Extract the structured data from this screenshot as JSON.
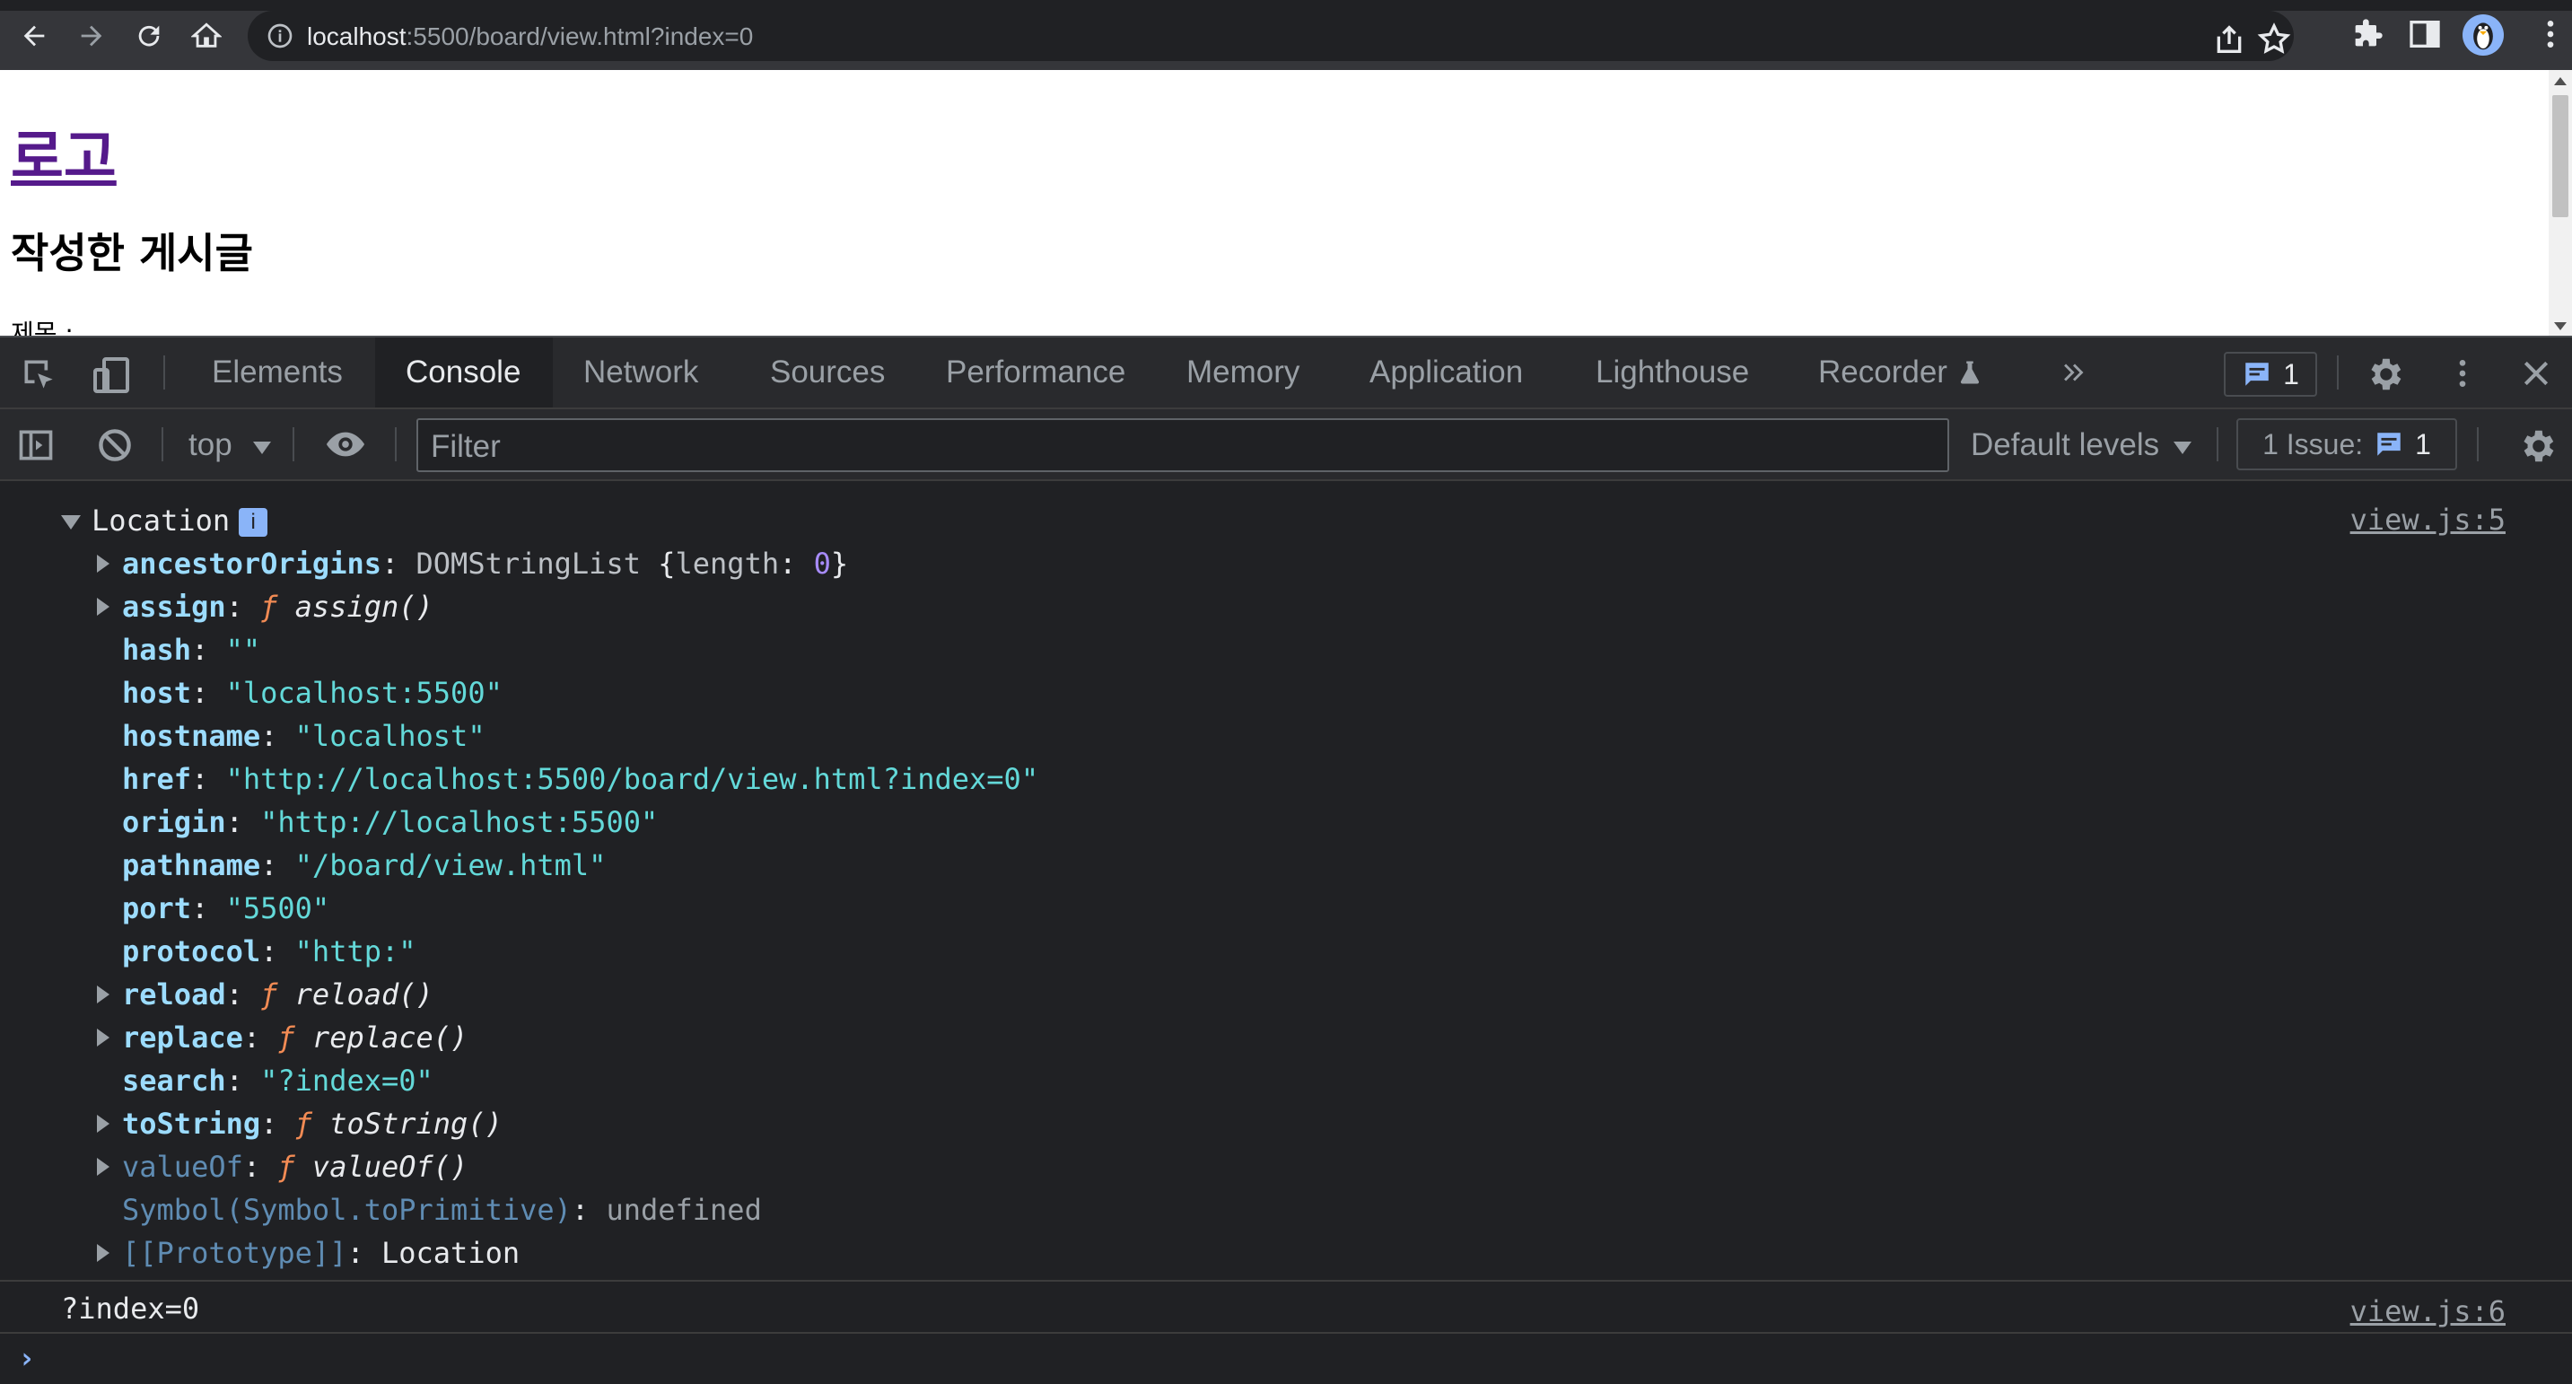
{
  "browser": {
    "url_host": "localhost",
    "url_rest": ":5500/board/view.html?index=0"
  },
  "page": {
    "logo": "로고",
    "heading": "작성한 게시글",
    "label": "제목 :"
  },
  "devtools": {
    "tabs": [
      "Elements",
      "Console",
      "Network",
      "Sources",
      "Performance",
      "Memory",
      "Application",
      "Lighthouse",
      "Recorder"
    ],
    "active_tab": "Console",
    "message_count": "1",
    "context": "top",
    "filter_placeholder": "Filter",
    "levels": "Default levels",
    "issues_label": "1 Issue:",
    "issues_count": "1"
  },
  "console": {
    "object_name": "Location",
    "source1": "view.js:5",
    "source2": "view.js:6",
    "props": {
      "ancestorOrigins_key": "ancestorOrigins",
      "ancestorOrigins_cls": "DOMStringList",
      "ancestorOrigins_lenkey": "length",
      "ancestorOrigins_len": "0",
      "assign_key": "assign",
      "assign_fn": "assign()",
      "hash_key": "hash",
      "hash_val": "\"\"",
      "host_key": "host",
      "host_val": "\"localhost:5500\"",
      "hostname_key": "hostname",
      "hostname_val": "\"localhost\"",
      "href_key": "href",
      "href_val": "\"http://localhost:5500/board/view.html?index=0\"",
      "origin_key": "origin",
      "origin_val": "\"http://localhost:5500\"",
      "pathname_key": "pathname",
      "pathname_val": "\"/board/view.html\"",
      "port_key": "port",
      "port_val": "\"5500\"",
      "protocol_key": "protocol",
      "protocol_val": "\"http:\"",
      "reload_key": "reload",
      "reload_fn": "reload()",
      "replace_key": "replace",
      "replace_fn": "replace()",
      "search_key": "search",
      "search_val": "\"?index=0\"",
      "toString_key": "toString",
      "toString_fn": "toString()",
      "valueOf_key": "valueOf",
      "valueOf_fn": "valueOf()",
      "symbol_key": "Symbol(Symbol.toPrimitive)",
      "symbol_val": "undefined",
      "proto_key": "[[Prototype]]",
      "proto_val": "Location"
    },
    "f_glyph": "ƒ",
    "output2": "?index=0"
  },
  "colors": {
    "link": "#551a8b",
    "console_key": "#9cdcfe",
    "console_string": "#63d9d9",
    "console_fn": "#f28b54"
  }
}
